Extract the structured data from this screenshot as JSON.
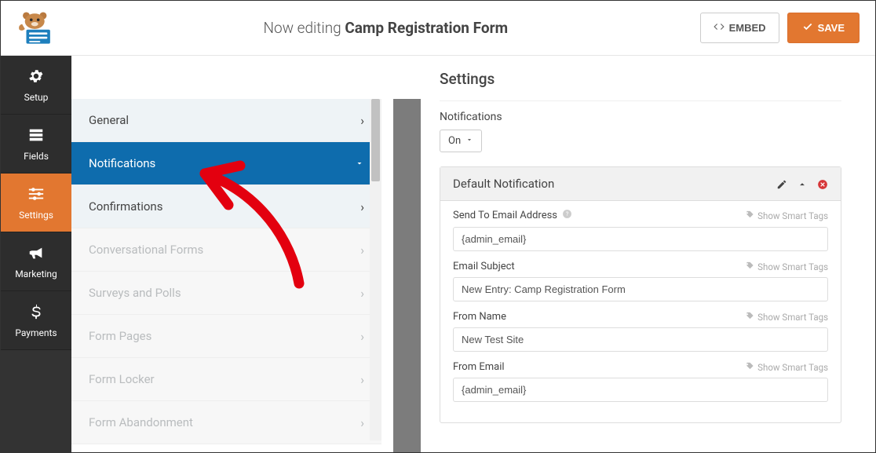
{
  "header": {
    "editing_prefix": "Now editing ",
    "form_name": "Camp Registration Form",
    "embed_label": "EMBED",
    "save_label": "SAVE"
  },
  "sidebar": {
    "items": [
      {
        "label": "Setup"
      },
      {
        "label": "Fields"
      },
      {
        "label": "Settings"
      },
      {
        "label": "Marketing"
      },
      {
        "label": "Payments"
      }
    ]
  },
  "submenu": {
    "items": [
      {
        "label": "General",
        "state": "normal"
      },
      {
        "label": "Notifications",
        "state": "active"
      },
      {
        "label": "Confirmations",
        "state": "normal"
      },
      {
        "label": "Conversational Forms",
        "state": "disabled"
      },
      {
        "label": "Surveys and Polls",
        "state": "disabled"
      },
      {
        "label": "Form Pages",
        "state": "disabled"
      },
      {
        "label": "Form Locker",
        "state": "disabled"
      },
      {
        "label": "Form Abandonment",
        "state": "disabled"
      }
    ]
  },
  "main": {
    "title": "Settings",
    "notifications_label": "Notifications",
    "toggle_value": "On",
    "panel_title": "Default Notification",
    "smart_tags_text": "Show Smart Tags",
    "fields": {
      "send_to": {
        "label": "Send To Email Address",
        "value": "{admin_email}"
      },
      "subject": {
        "label": "Email Subject",
        "value": "New Entry: Camp Registration Form"
      },
      "from_name": {
        "label": "From Name",
        "value": "New Test Site"
      },
      "from_email": {
        "label": "From Email",
        "value": "{admin_email}"
      }
    }
  }
}
